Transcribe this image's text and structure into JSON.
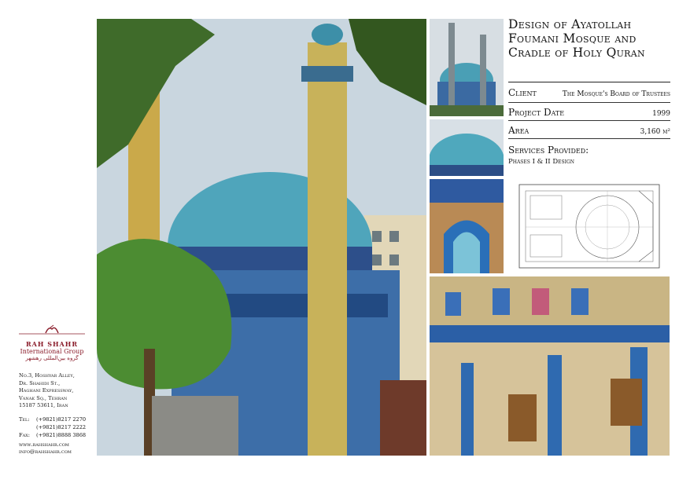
{
  "project": {
    "title": "Design of Ayatollah Foumani Mosque and Cradle of Holy Quran",
    "client_label": "Client",
    "client_value": "The Mosque's Board of Trustees",
    "date_label": "Project Date",
    "date_value": "1999",
    "area_label": "Area",
    "area_value": "3,160 m²",
    "services_label": "Services Provided:",
    "services_value": "Phases I & II Design"
  },
  "company": {
    "logo_name": "RAH SHAHR",
    "logo_sub": "International Group",
    "logo_fa": "گروه بین‌المللی رهشهر",
    "address": [
      "No.3, Hoshyar Alley,",
      "Dr. Shahidi St.,",
      "Haghani Expressway,",
      "Vanak Sq., Tehran",
      "15187 53611, Iran"
    ],
    "contacts": [
      {
        "label": "Tel:",
        "value": "(+9821)8217 2270"
      },
      {
        "label": "",
        "value": "(+9821)8217 2222"
      },
      {
        "label": "Fax:",
        "value": "(+9821)8888 3868"
      }
    ],
    "website": "www.rahshahr.com",
    "email": "info@rahshahr.com"
  },
  "colors": {
    "dome": "#5fb4c4",
    "tile": "#2f5fa8",
    "brand": "#8a1c2a"
  },
  "icons": [
    "mosque-photo",
    "floor-plan-drawing"
  ]
}
